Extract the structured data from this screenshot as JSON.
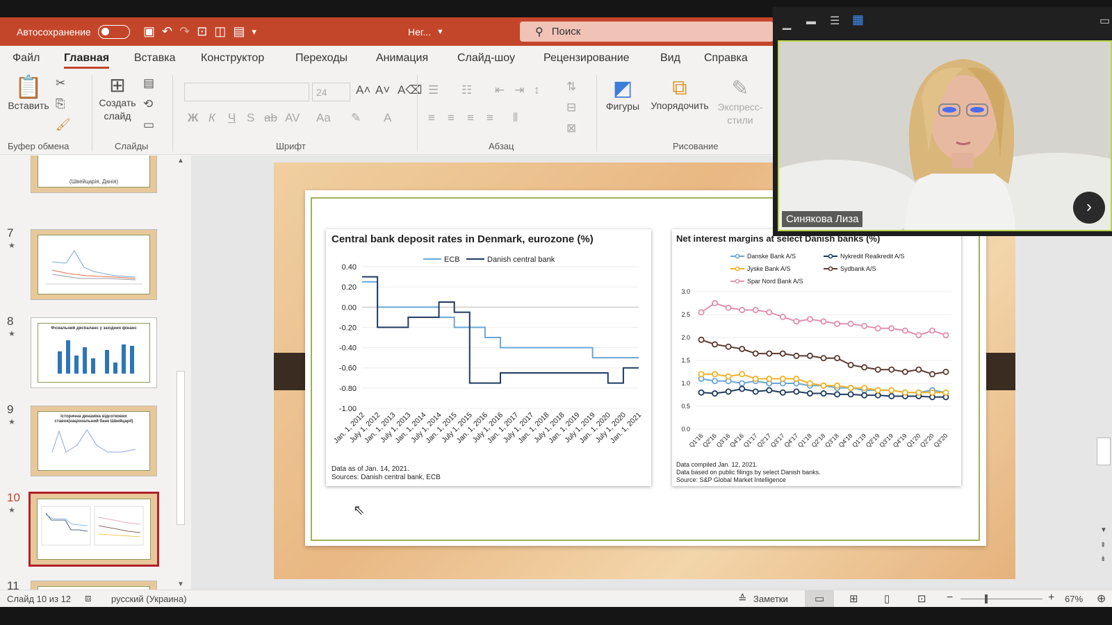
{
  "titlebar": {
    "autosave_label": "Автосохранение",
    "file_name": "Нег...",
    "search_placeholder": "Поиск"
  },
  "tabs": [
    {
      "label": "Файл"
    },
    {
      "label": "Главная"
    },
    {
      "label": "Вставка"
    },
    {
      "label": "Конструктор"
    },
    {
      "label": "Переходы"
    },
    {
      "label": "Анимация"
    },
    {
      "label": "Слайд-шоу"
    },
    {
      "label": "Рецензирование"
    },
    {
      "label": "Вид"
    },
    {
      "label": "Справка"
    }
  ],
  "ribbon": {
    "paste_label": "Вставить",
    "new_slide_label": "Создать слайд",
    "font_size": "24",
    "shapes_label": "Фигуры",
    "arrange_label": "Упорядочить",
    "quick_styles_label": "Экспресс-стили",
    "groups": {
      "clipboard": "Буфер обмена",
      "slides": "Слайды",
      "font": "Шрифт",
      "paragraph": "Абзац",
      "drawing": "Рисование"
    }
  },
  "slides_panel": {
    "numbers": [
      "7",
      "8",
      "9",
      "10",
      "11"
    ],
    "selected": "10",
    "slide6_caption": "(Швейцарія, Данія)",
    "slide8_title": "Фіскальний дисбаланс у західних фінанс",
    "slide9_title": "Історична динаміка відсоткових ставок(національний банк Швейцарії)"
  },
  "chart_left": {
    "title": "Central bank deposit rates in Denmark, eurozone (%)",
    "legend": [
      "ECB",
      "Danish central bank"
    ],
    "yticks": [
      "0.40",
      "0.20",
      "0.00",
      "-0.20",
      "-0.40",
      "-0.60",
      "-0.80",
      "-1.00"
    ],
    "xticks": [
      "Jan. 1, 2012",
      "July 1, 2012",
      "Jan. 1, 2013",
      "July 1, 2013",
      "Jan. 1, 2014",
      "July 1, 2014",
      "Jan. 1, 2015",
      "July 1, 2015",
      "Jan. 1, 2016",
      "July 1, 2016",
      "Jan. 1, 2017",
      "July 1, 2017",
      "Jan. 1, 2018",
      "July 1, 2018",
      "Jan. 1, 2019",
      "July 1, 2019",
      "Jan. 1, 2020",
      "July 1, 2020",
      "Jan. 1, 2021"
    ],
    "note1": "Data as of Jan. 14, 2021.",
    "note2": "Sources: Danish central bank, ECB"
  },
  "chart_right": {
    "title": "Net interest margins at select Danish banks (%)",
    "legend": [
      "Danske Bank A/S",
      "Nykredit Realkredit A/S",
      "Jyske Bank A/S",
      "Sydbank A/S",
      "Spar Nord Bank A/S"
    ],
    "yticks": [
      "3.0",
      "2.5",
      "2.0",
      "1.5",
      "1.0",
      "0.5",
      "0.0"
    ],
    "xticks": [
      "Q1'16",
      "Q2'16",
      "Q3'16",
      "Q4'16",
      "Q1'17",
      "Q2'17",
      "Q3'17",
      "Q4'17",
      "Q1'18",
      "Q2'18",
      "Q3'18",
      "Q4'18",
      "Q1'19",
      "Q2'19",
      "Q3'19",
      "Q4'19",
      "Q1'20",
      "Q2'20",
      "Q3'20"
    ],
    "note1": "Data compiled Jan. 12, 2021.",
    "note2": "Data based on public filings by select Danish banks.",
    "note3": "Source: S&P Global Market Intelligence"
  },
  "chart_data": [
    {
      "type": "line",
      "title": "Central bank deposit rates in Denmark, eurozone (%)",
      "x": [
        "Jan. 1, 2012",
        "July 1, 2012",
        "Jan. 1, 2013",
        "July 1, 2013",
        "Jan. 1, 2014",
        "July 1, 2014",
        "Jan. 1, 2015",
        "July 1, 2015",
        "Jan. 1, 2016",
        "July 1, 2016",
        "Jan. 1, 2017",
        "July 1, 2017",
        "Jan. 1, 2018",
        "July 1, 2018",
        "Jan. 1, 2019",
        "July 1, 2019",
        "Jan. 1, 2020",
        "July 1, 2020",
        "Jan. 1, 2021"
      ],
      "ylim": [
        -1.0,
        0.4
      ],
      "series": [
        {
          "name": "ECB",
          "color": "#6aa6d6",
          "values": [
            0.25,
            0.0,
            0.0,
            0.0,
            0.0,
            -0.1,
            -0.2,
            -0.2,
            -0.3,
            -0.4,
            -0.4,
            -0.4,
            -0.4,
            -0.4,
            -0.4,
            -0.5,
            -0.5,
            -0.5,
            -0.5
          ]
        },
        {
          "name": "Danish central bank",
          "color": "#1f3a5f",
          "values": [
            0.3,
            -0.2,
            -0.2,
            -0.1,
            -0.1,
            0.05,
            -0.05,
            -0.75,
            -0.75,
            -0.65,
            -0.65,
            -0.65,
            -0.65,
            -0.65,
            -0.65,
            -0.65,
            -0.75,
            -0.6,
            -0.6
          ]
        }
      ]
    },
    {
      "type": "line",
      "title": "Net interest margins at select Danish banks (%)",
      "x": [
        "Q1'16",
        "Q2'16",
        "Q3'16",
        "Q4'16",
        "Q1'17",
        "Q2'17",
        "Q3'17",
        "Q4'17",
        "Q1'18",
        "Q2'18",
        "Q3'18",
        "Q4'18",
        "Q1'19",
        "Q2'19",
        "Q3'19",
        "Q4'19",
        "Q1'20",
        "Q2'20",
        "Q3'20"
      ],
      "ylim": [
        0.0,
        3.0
      ],
      "series": [
        {
          "name": "Danske Bank A/S",
          "color": "#6aa6d6",
          "values": [
            1.1,
            1.05,
            1.05,
            1.0,
            1.05,
            1.0,
            1.0,
            1.0,
            0.95,
            0.95,
            0.9,
            0.9,
            0.85,
            0.85,
            0.85,
            0.8,
            0.8,
            0.85,
            0.8
          ]
        },
        {
          "name": "Nykredit Realkredit A/S",
          "color": "#1f3a5f",
          "values": [
            0.8,
            0.78,
            0.82,
            0.88,
            0.82,
            0.85,
            0.8,
            0.82,
            0.78,
            0.78,
            0.76,
            0.76,
            0.74,
            0.74,
            0.72,
            0.72,
            0.72,
            0.7,
            0.7
          ]
        },
        {
          "name": "Jyske Bank A/S",
          "color": "#f0b429",
          "values": [
            1.2,
            1.2,
            1.15,
            1.2,
            1.1,
            1.1,
            1.1,
            1.1,
            1.0,
            0.95,
            0.95,
            0.9,
            0.9,
            0.85,
            0.85,
            0.8,
            0.8,
            0.8,
            0.8
          ]
        },
        {
          "name": "Sydbank A/S",
          "color": "#5a3a2e",
          "values": [
            1.95,
            1.85,
            1.8,
            1.75,
            1.65,
            1.65,
            1.65,
            1.6,
            1.6,
            1.55,
            1.55,
            1.4,
            1.35,
            1.3,
            1.3,
            1.25,
            1.3,
            1.2,
            1.25
          ]
        },
        {
          "name": "Spar Nord Bank A/S",
          "color": "#e38fb0",
          "values": [
            2.55,
            2.75,
            2.65,
            2.6,
            2.6,
            2.55,
            2.45,
            2.35,
            2.4,
            2.35,
            2.3,
            2.3,
            2.25,
            2.2,
            2.2,
            2.15,
            2.05,
            2.15,
            2.05
          ]
        }
      ]
    }
  ],
  "video": {
    "participant_name": "Синякова Лиза"
  },
  "status": {
    "slide_counter": "Слайд 10 из 12",
    "language": "русский (Украина)",
    "notes_label": "Заметки",
    "zoom": "67%"
  }
}
